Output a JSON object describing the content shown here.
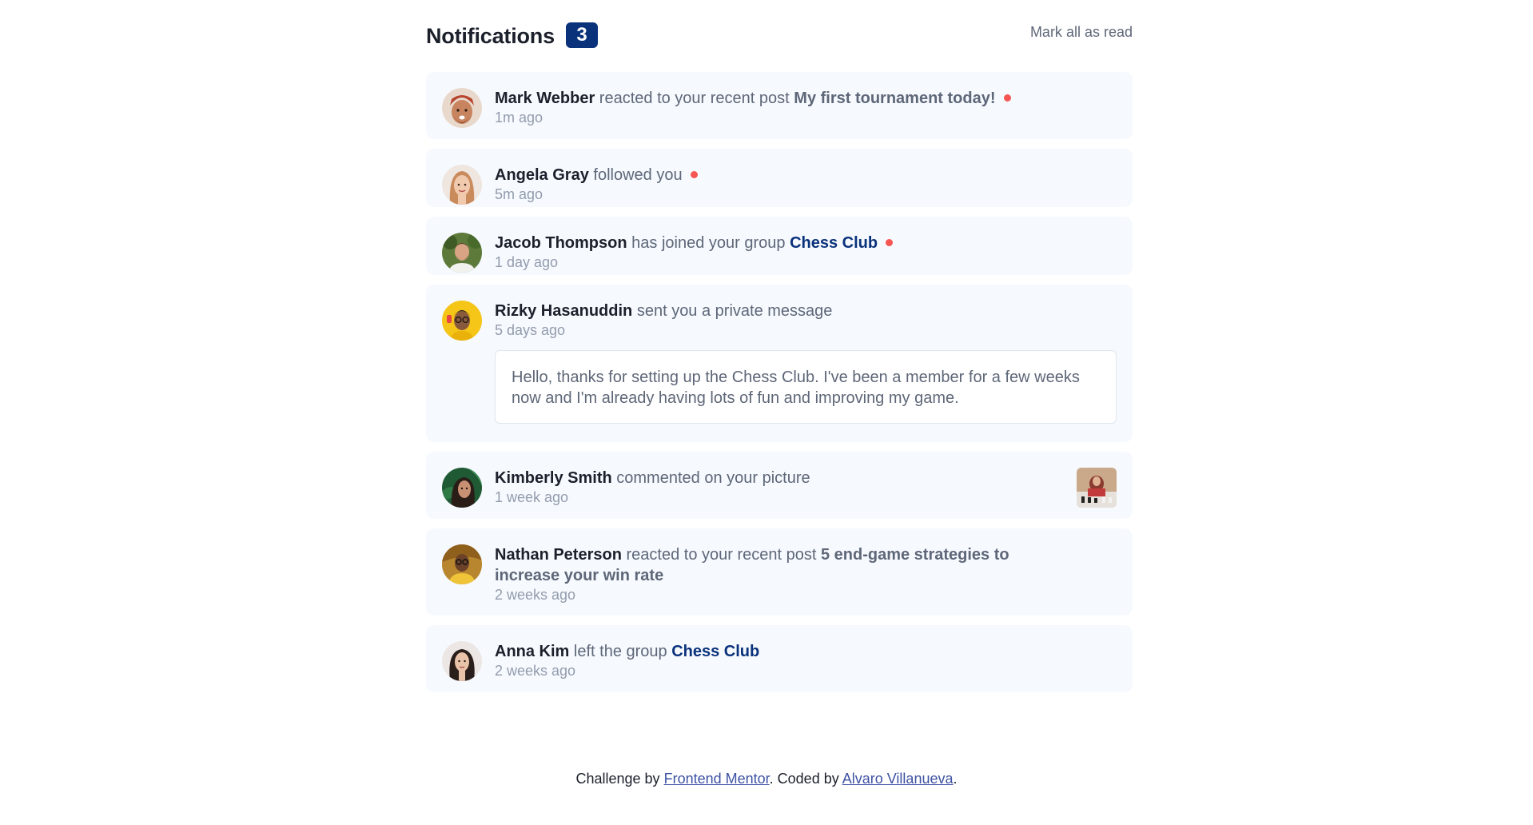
{
  "header": {
    "title": "Notifications",
    "unread_count": "3",
    "mark_all_label": "Mark all as read"
  },
  "notifications": [
    {
      "name": "Mark Webber",
      "action": "reacted to your recent post",
      "post": "My first tournament today!",
      "time": "1m ago",
      "unread": true
    },
    {
      "name": "Angela Gray",
      "action": "followed you",
      "time": "5m ago",
      "unread": true
    },
    {
      "name": "Jacob Thompson",
      "action": "has joined your group",
      "group": "Chess Club",
      "time": "1 day ago",
      "unread": true
    },
    {
      "name": "Rizky Hasanuddin",
      "action": "sent you a private message",
      "time": "5 days ago",
      "message": "Hello, thanks for setting up the Chess Club. I've been a member for a few weeks now and I'm already having lots of fun and improving my game.",
      "unread": false
    },
    {
      "name": "Kimberly Smith",
      "action": "commented on your picture",
      "time": "1 week ago",
      "unread": false
    },
    {
      "name": "Nathan Peterson",
      "action": "reacted to your recent post",
      "post": "5 end-game strategies to increase your win rate",
      "time": "2 weeks ago",
      "unread": false
    },
    {
      "name": "Anna Kim",
      "action": "left the group",
      "group": "Chess Club",
      "time": "2 weeks ago",
      "unread": false
    }
  ],
  "footer": {
    "prefix": "Challenge by",
    "link1": "Frontend Mentor",
    "middle": ". Coded by",
    "link2": "Alvaro Villanueva",
    "suffix": "."
  },
  "colors": {
    "badge": "#0a327b",
    "unread_dot": "#f65552",
    "card_bg": "#f6f9fe",
    "group_link": "#0a327b"
  }
}
